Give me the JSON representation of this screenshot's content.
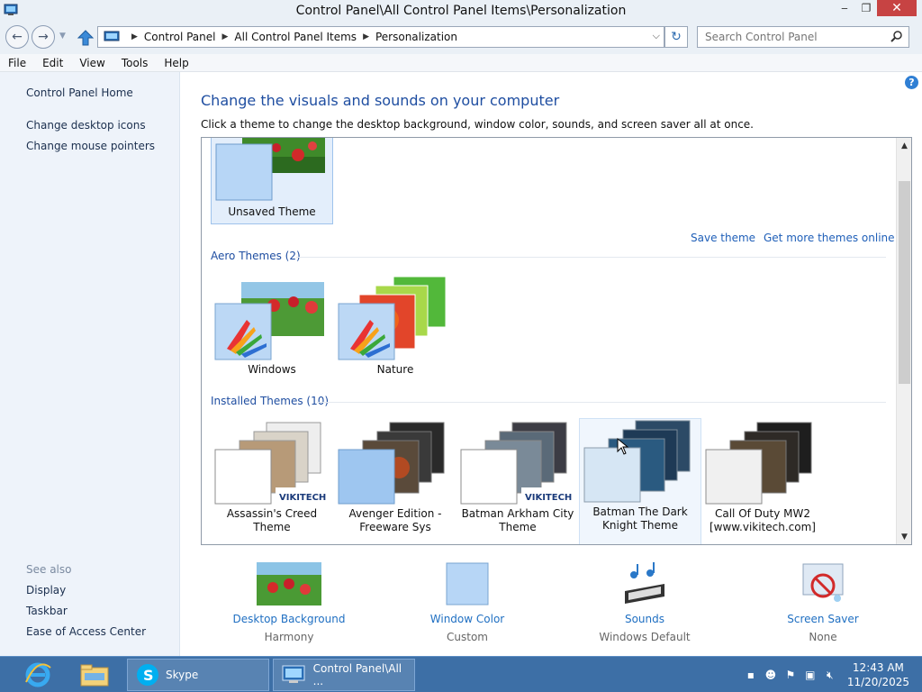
{
  "window": {
    "title": "Control Panel\\All Control Panel Items\\Personalization",
    "minimize": "‒",
    "restore": "❐",
    "close": "✕"
  },
  "address_bar": {
    "crumbs": [
      "Control Panel",
      "All Control Panel Items",
      "Personalization"
    ],
    "search_placeholder": "Search Control Panel"
  },
  "menu": [
    "File",
    "Edit",
    "View",
    "Tools",
    "Help"
  ],
  "left_pane": {
    "links": [
      "Control Panel Home",
      "Change desktop icons",
      "Change mouse pointers"
    ],
    "see_also_heading": "See also",
    "see_also": [
      "Display",
      "Taskbar",
      "Ease of Access Center"
    ]
  },
  "main": {
    "title": "Change the visuals and sounds on your computer",
    "subtitle": "Click a theme to change the desktop background, window color, sounds, and screen saver all at once.",
    "unsaved_theme": "Unsaved Theme",
    "save_theme": "Save theme",
    "get_more": "Get more themes online",
    "aero_heading": "Aero Themes (2)",
    "aero_themes": [
      "Windows",
      "Nature"
    ],
    "installed_heading": "Installed Themes (10)",
    "installed_themes": [
      {
        "line1": "Assassin's Creed",
        "line2": "Theme"
      },
      {
        "line1": "Avenger Edition -",
        "line2": "Freeware Sys"
      },
      {
        "line1": "Batman Arkham City",
        "line2": "Theme"
      },
      {
        "line1": "Batman The Dark",
        "line2": "Knight Theme"
      },
      {
        "line1": "Call Of Duty MW2",
        "line2": "[www.vikitech.com]"
      }
    ],
    "watermark": "VIKITECH"
  },
  "bottom": [
    {
      "link": "Desktop Background",
      "value": "Harmony"
    },
    {
      "link": "Window Color",
      "value": "Custom"
    },
    {
      "link": "Sounds",
      "value": "Windows Default"
    },
    {
      "link": "Screen Saver",
      "value": "None"
    }
  ],
  "taskbar": {
    "skype": "Skype",
    "control_panel": "Control Panel\\All ...",
    "time": "12:43 AM",
    "date": "11/20/2025"
  },
  "colors": {
    "accent": "#1f5fb8",
    "taskbar": "#3d6fa6",
    "close_button": "#c74343"
  }
}
